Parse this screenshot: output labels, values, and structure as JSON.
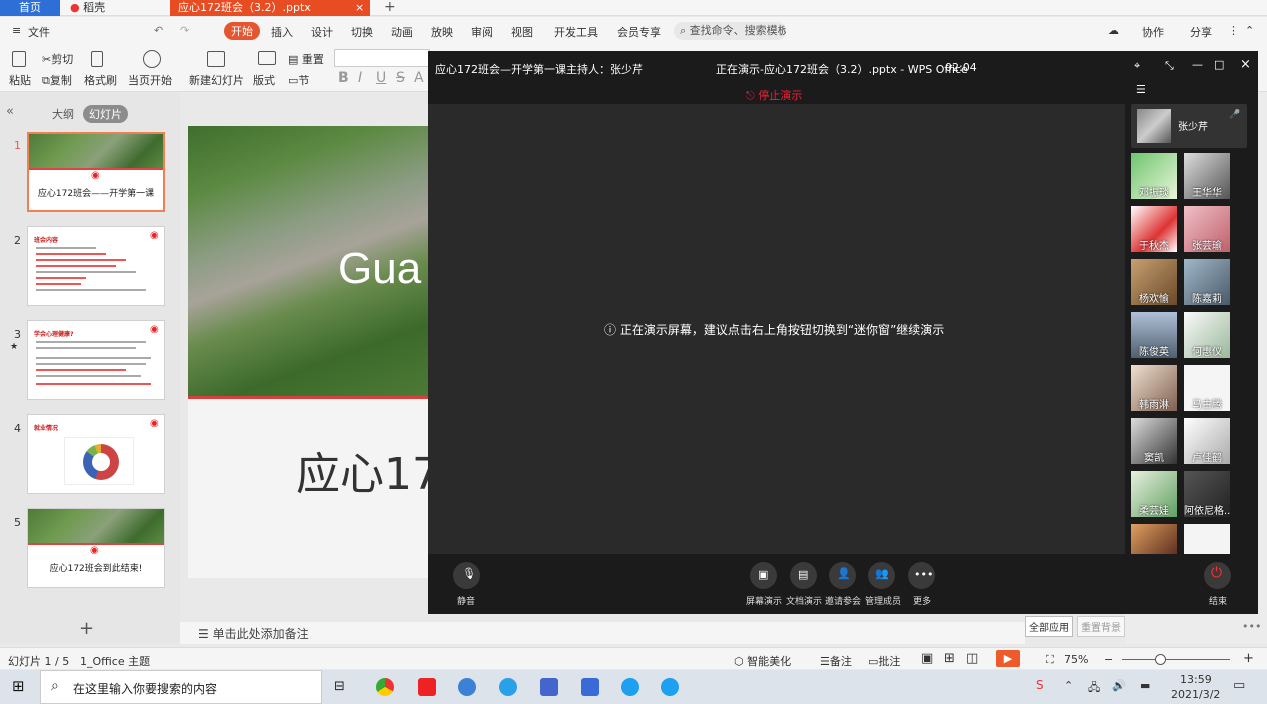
{
  "titlebar": {
    "tabs": [
      "首页",
      "稻壳",
      "应心172班会（3.2）.pptx"
    ]
  },
  "menubar": {
    "file": "文件",
    "items": [
      "开始",
      "插入",
      "设计",
      "切换",
      "动画",
      "放映",
      "审阅",
      "视图",
      "开发工具",
      "会员专享"
    ],
    "search_placeholder": "查找命令、搜索模板",
    "right": [
      "协作",
      "分享"
    ]
  },
  "ribbon": {
    "paste": "粘贴",
    "cut": "剪切",
    "copy": "复制",
    "format_painter": "格式刷",
    "from_current": "当页开始",
    "new_slide": "新建幻灯片",
    "layout": "版式",
    "section": "节",
    "reset": "重置"
  },
  "leftpanel": {
    "outline": "大纲",
    "slides": "幻灯片",
    "slide_numbers": [
      "1",
      "2",
      "3",
      "4",
      "5"
    ],
    "thumb1_title": "应心172班会——开学第一课",
    "thumb5_title": "应心172班会到此结束!",
    "thumb2_head": "班会内容",
    "thumb3_head": "学会心理健康?",
    "thumb4_head": "就业情况",
    "add": "+"
  },
  "slide": {
    "overlay_text": "Gua",
    "title": "应心17"
  },
  "notes": {
    "placeholder": "单击此处添加备注"
  },
  "statusbar": {
    "slide_count": "幻灯片 1 / 5",
    "theme": "1_Office 主题",
    "beautify": "智能美化",
    "notes": "备注",
    "comments": "批注",
    "zoom": "75%"
  },
  "rightpanel": {
    "apply_all": "全部应用",
    "reset_bg": "重置背景"
  },
  "meeting": {
    "title": "应心172班会—开学第一课",
    "host_label": "主持人：张少芹",
    "status": "正在演示-应心172班会（3.2）.pptx - WPS Office",
    "timer": "02:04",
    "stop": "停止演示",
    "notice": "正在演示屏幕，建议点击右上角按钮切换到“迷你窗”继续演示",
    "host_name": "张少芹",
    "participants": [
      "邓振琰",
      "王华华",
      "于秋杰",
      "张芸瑜",
      "杨欢愉",
      "陈嘉莉",
      "陈俊英",
      "何惠仪",
      "韩雨淋",
      "马古腾",
      "窦凯",
      "卢佳鹤",
      "柔芸娃",
      "阿依尼格..."
    ],
    "controls": {
      "mute": "静音",
      "screen": "屏幕演示",
      "doc": "文档演示",
      "invite": "邀请参会",
      "manage": "管理成员",
      "more": "更多",
      "end": "结束"
    }
  },
  "taskbar": {
    "search_placeholder": "在这里输入你要搜索的内容",
    "time": "13:59",
    "date": "2021/3/2"
  }
}
